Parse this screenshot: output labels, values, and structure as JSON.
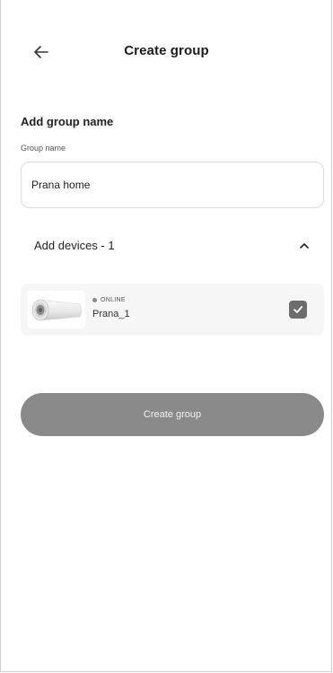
{
  "header": {
    "back_icon": "arrow-left-icon",
    "title": "Create group"
  },
  "group_name": {
    "heading": "Add group name",
    "label": "Group name",
    "value": "Prana home"
  },
  "devices": {
    "title": "Add devices - 1",
    "toggle_icon": "chevron-up-icon",
    "expanded": true,
    "items": [
      {
        "status": "ONLINE",
        "name": "Prana_1",
        "checked": true,
        "image_icon": "ventilator-device-icon",
        "checkbox_icon": "checkmark-icon"
      }
    ]
  },
  "actions": {
    "create_label": "Create group"
  },
  "colors": {
    "button_bg": "#8a8a8a",
    "card_bg": "#f6f6f6",
    "checkbox_bg": "#6d6d6d",
    "status_dot": "#8a8a8a"
  }
}
